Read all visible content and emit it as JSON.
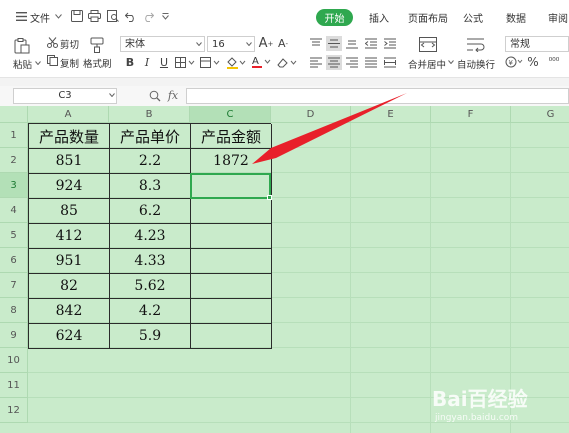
{
  "menubar": {
    "file_label": "文件",
    "tabs": [
      {
        "label": "开始",
        "active": true
      },
      {
        "label": "插入"
      },
      {
        "label": "页面布局"
      },
      {
        "label": "公式"
      },
      {
        "label": "数据"
      },
      {
        "label": "审阅"
      }
    ]
  },
  "ribbon": {
    "paste_label": "粘贴",
    "cut_label": "剪切",
    "copy_label": "复制",
    "format_painter_label": "格式刷",
    "font_name": "宋体",
    "font_size": "16",
    "merge_center_label": "合并居中",
    "wrap_text_label": "自动换行",
    "number_format": "常规",
    "accent_color": "#2fa84f"
  },
  "formula_bar": {
    "name_box": "C3",
    "fx_label": "fx",
    "formula": ""
  },
  "sheet": {
    "columns": [
      "A",
      "B",
      "C",
      "D",
      "E",
      "F",
      "G"
    ],
    "rows": [
      "1",
      "2",
      "3",
      "4",
      "5",
      "6",
      "7",
      "8",
      "9",
      "10",
      "11",
      "12"
    ],
    "selected_column": "C",
    "selected_row": "3",
    "header_row": [
      "产品数量",
      "产品单价",
      "产品金额"
    ],
    "data": [
      [
        "851",
        "2.2",
        "1872"
      ],
      [
        "924",
        "8.3",
        ""
      ],
      [
        "85",
        "6.2",
        ""
      ],
      [
        "412",
        "4.23",
        ""
      ],
      [
        "951",
        "4.33",
        ""
      ],
      [
        "82",
        "5.62",
        ""
      ],
      [
        "842",
        "4.2",
        ""
      ],
      [
        "624",
        "5.9",
        ""
      ]
    ],
    "background_color": "#c9ebcb",
    "annotation_arrow_color": "#e8202a"
  },
  "watermark": {
    "logo_text": "Bai百经验",
    "url": "jingyan.baidu.com"
  }
}
